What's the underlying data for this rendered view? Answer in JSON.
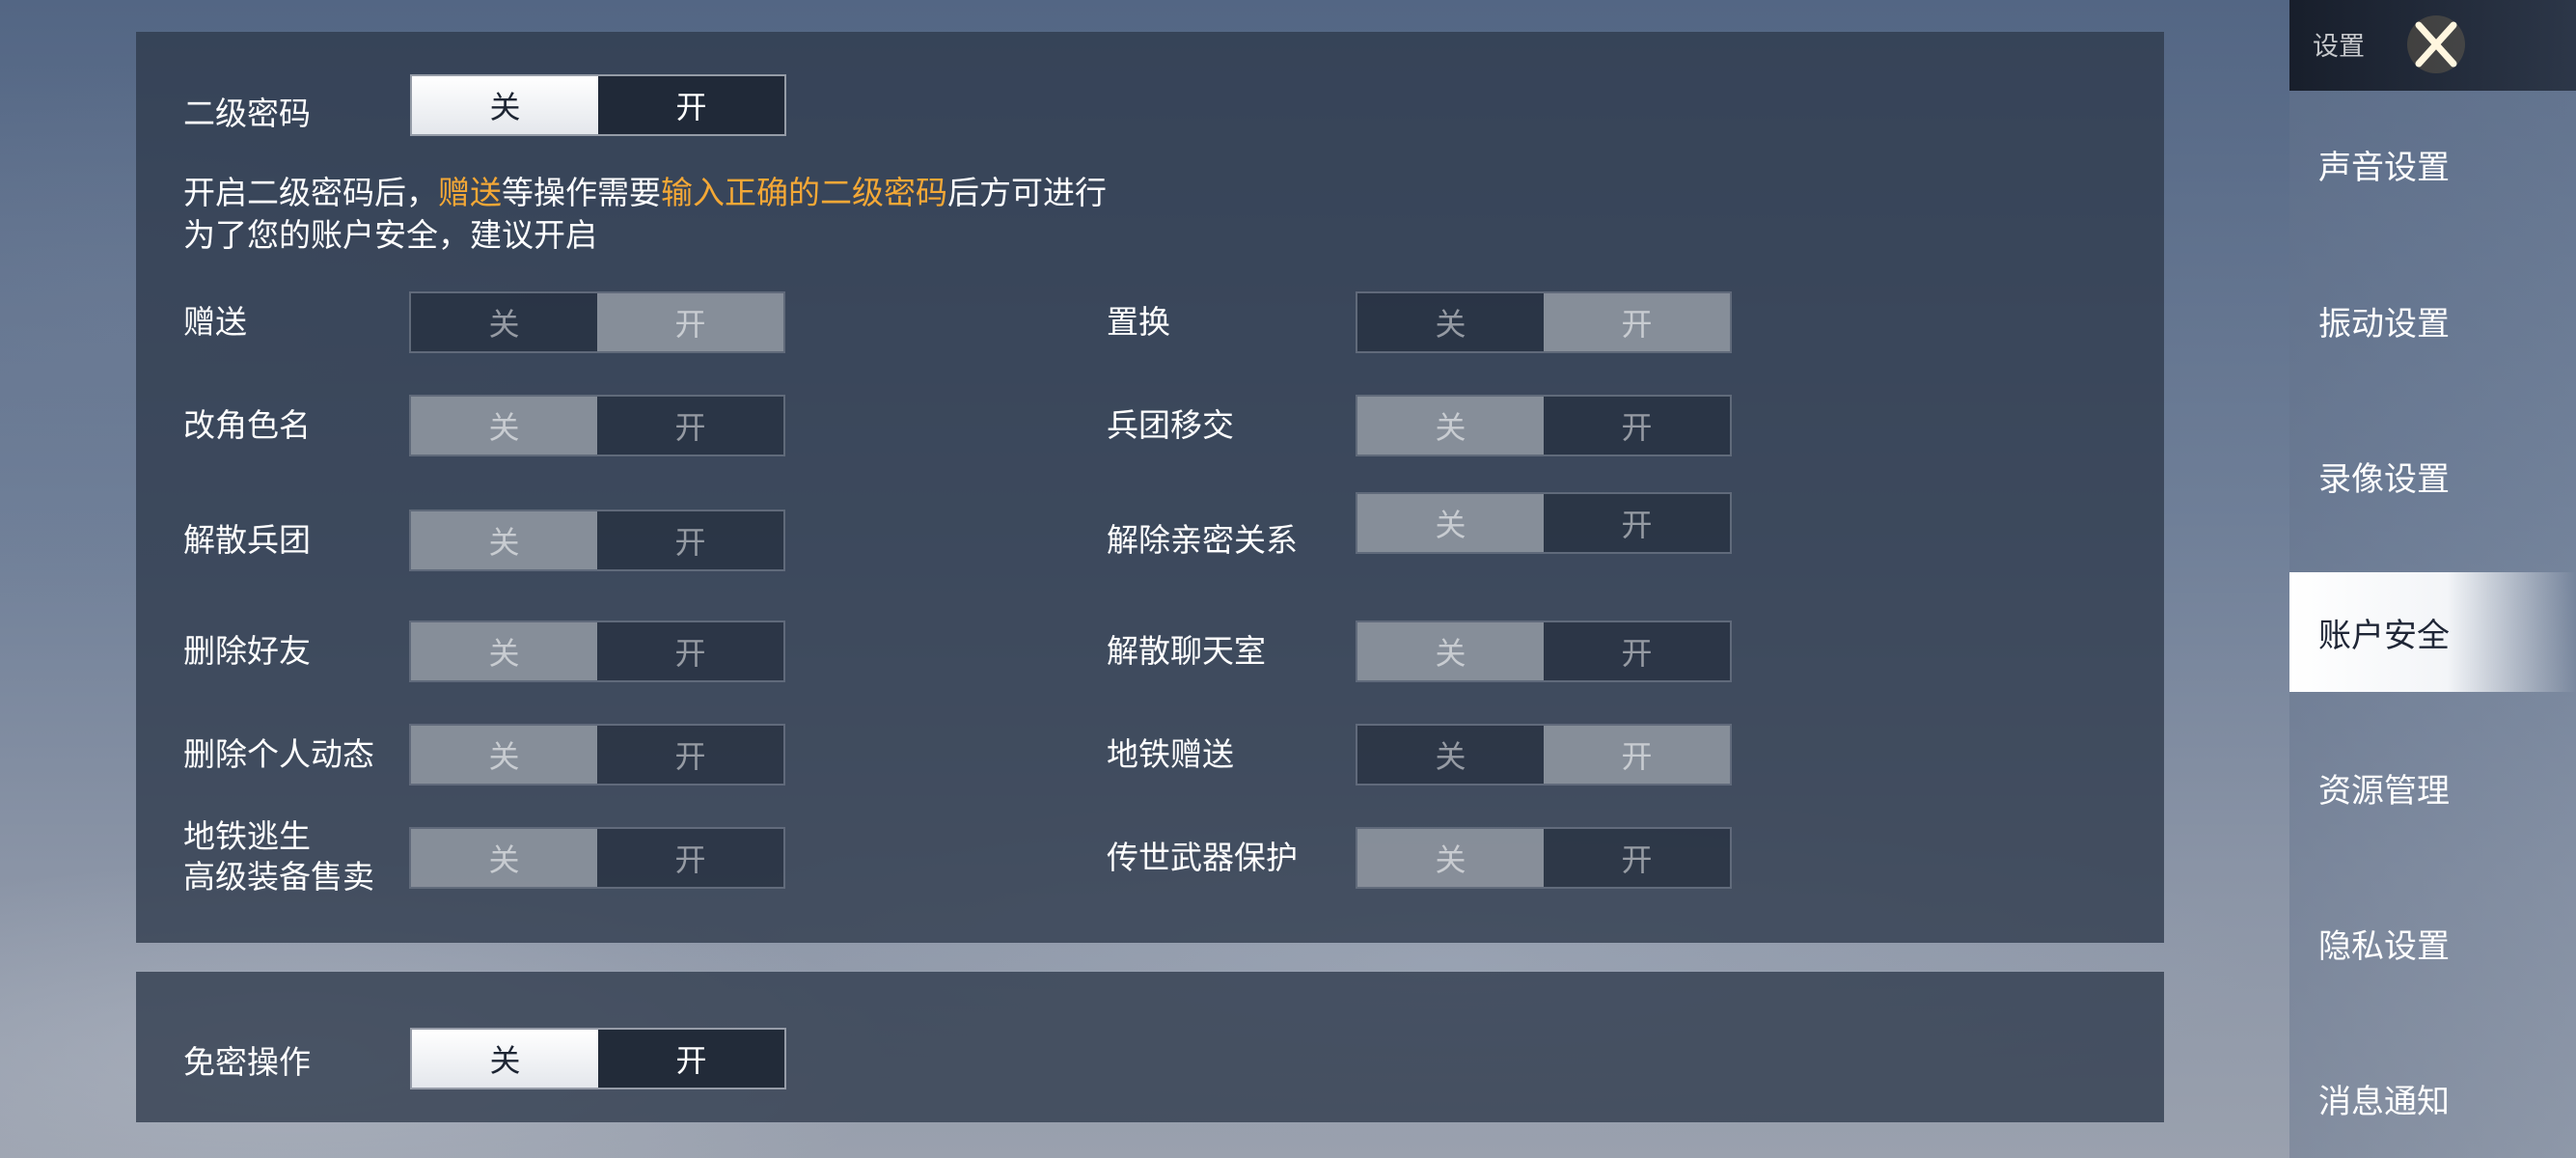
{
  "settings": {
    "secondary_password": {
      "label": "二级密码",
      "off": "关",
      "on": "开",
      "state": "off"
    },
    "desc_line1": {
      "part1": "开启二级密码后，",
      "highlight1": "赠送",
      "part2": "等操作需要",
      "highlight2": "输入正确的二级密码",
      "part3": "后方可进行"
    },
    "desc_line2": "为了您的账户安全，建议开启",
    "items": [
      {
        "label": "赠送",
        "state": "on"
      },
      {
        "label": "置换",
        "state": "on"
      },
      {
        "label": "改角色名",
        "state": "off"
      },
      {
        "label": "兵团移交",
        "state": "off"
      },
      {
        "label": "解散兵团",
        "state": "off"
      },
      {
        "label": "解除亲密关系",
        "state": "off"
      },
      {
        "label": "删除好友",
        "state": "off"
      },
      {
        "label": "解散聊天室",
        "state": "off"
      },
      {
        "label": "删除个人动态",
        "state": "off"
      },
      {
        "label": "地铁赠送",
        "state": "on"
      },
      {
        "label_line1": "地铁逃生",
        "label_line2": "高级装备售卖",
        "state": "off"
      },
      {
        "label": "传世武器保护",
        "state": "off"
      }
    ],
    "no_password": {
      "label": "免密操作",
      "off": "关",
      "on": "开",
      "state": "off"
    },
    "toggle_off": "关",
    "toggle_on": "开"
  },
  "sidebar": {
    "title": "设置",
    "close_icon": "close-x-icon",
    "items": [
      {
        "label": "声音设置"
      },
      {
        "label": "振动设置"
      },
      {
        "label": "录像设置"
      },
      {
        "label": "账户安全",
        "active": true
      },
      {
        "label": "资源管理"
      },
      {
        "label": "隐私设置"
      },
      {
        "label": "消息通知"
      }
    ]
  },
  "colors": {
    "highlight": "#f4a836",
    "panel": "#2e3a4c"
  }
}
